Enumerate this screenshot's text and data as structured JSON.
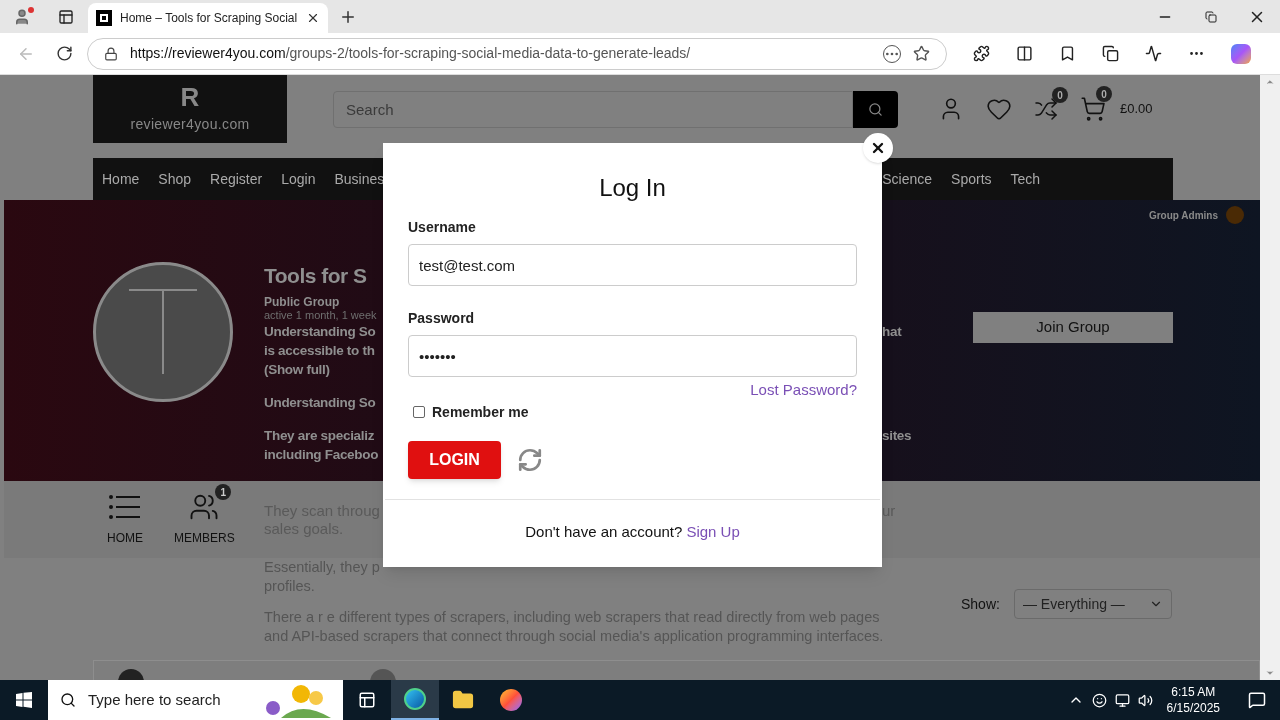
{
  "browser": {
    "tab_title": "Home – Tools for Scraping Social",
    "url_host": "https://reviewer4you.com",
    "url_path": "/groups-2/tools-for-scraping-social-media-data-to-generate-leads/"
  },
  "site": {
    "logo_letter": "R",
    "logo_text": "reviewer4you.com",
    "search_placeholder": "Search",
    "compare_count": "0",
    "cart_count": "0",
    "cart_total": "£0.00",
    "nav_left": [
      "Home",
      "Shop",
      "Register",
      "Login",
      "Busines"
    ],
    "nav_right": [
      "Science",
      "Sports",
      "Tech"
    ]
  },
  "hero": {
    "admins_label": "Group Admins",
    "title": "Tools for S",
    "group_type": "Public Group",
    "activity": "active 1 month, 1 week",
    "paragraphs": [
      {
        "lines": [
          {
            "text": "Understanding So",
            "tail": "hat"
          },
          {
            "text": "is accessible to th"
          },
          {
            "text": "(Show full)"
          }
        ]
      },
      {
        "lines": [
          {
            "text": "Understanding So"
          }
        ]
      },
      {
        "lines": [
          {
            "text": "They are specializ",
            "tail": "sites"
          },
          {
            "text": "including Faceboo"
          }
        ]
      }
    ],
    "join": "Join Group"
  },
  "group_tabs": [
    {
      "label": "HOME",
      "kind": "home"
    },
    {
      "label": "MEMBERS",
      "kind": "members",
      "badge": "1"
    }
  ],
  "content": {
    "band_lines": [
      {
        "text": "They scan throug",
        "tail": "ur"
      },
      {
        "text": "sales goals."
      }
    ],
    "paragraphs": [
      {
        "lines": [
          {
            "text": "Essentially, they p"
          },
          {
            "text": "profiles."
          }
        ]
      },
      {
        "lines": [
          {
            "text": "There a r e different types of scrapers, including web scrapers that read directly from web pages"
          },
          {
            "text": "and API-based scrapers that connect through social media's application programming interfaces."
          }
        ]
      }
    ],
    "filter_label": "Show:",
    "filter_value": "— Everything —"
  },
  "modal": {
    "title": "Log In",
    "username_label": "Username",
    "username_value": "test@test.com",
    "password_label": "Password",
    "password_value": "•••••••",
    "lost_password": "Lost Password?",
    "remember_label": "Remember me",
    "remember_checked": false,
    "login": "LOGIN",
    "signup_prompt": "Don't have an account?",
    "signup_link": "Sign Up"
  },
  "taskbar": {
    "search_placeholder": "Type here to search",
    "time": "6:15 AM",
    "date": "6/15/2025"
  }
}
